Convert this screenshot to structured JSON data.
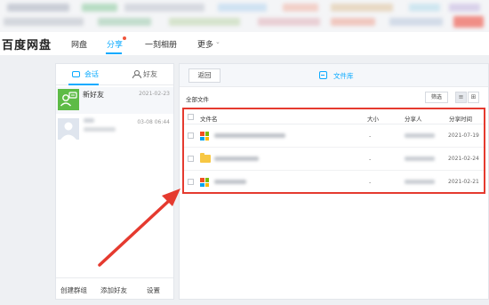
{
  "app": {
    "logo": "百度网盘"
  },
  "nav": {
    "items": [
      "网盘",
      "分享",
      "一刻相册",
      "更多"
    ],
    "active_index": 1
  },
  "left_panel": {
    "tabs": [
      "会话",
      "好友"
    ],
    "active_tab": "会话",
    "conversations": [
      {
        "name": "新好友",
        "date": "2021-02-23"
      },
      {
        "name": "",
        "date": "03-08 06:44"
      }
    ],
    "bottom_links": [
      "创建群组",
      "添加好友",
      "设置"
    ]
  },
  "right_panel": {
    "back_label": "返回",
    "library_label": "文件库",
    "all_files_label": "全部文件",
    "filter_label": "筛选",
    "columns": [
      "文件名",
      "大小",
      "分享人",
      "分享时间"
    ],
    "rows": [
      {
        "icon": "windows-app-icon",
        "size": "-",
        "date": "2021-07-19"
      },
      {
        "icon": "folder-icon",
        "size": "-",
        "date": "2021-02-24"
      },
      {
        "icon": "windows-app-icon",
        "size": "-",
        "date": "2021-02-21"
      }
    ]
  },
  "colors": {
    "accent": "#09aaff",
    "annotation_red": "#e53a2f",
    "folder": "#f7c743"
  }
}
